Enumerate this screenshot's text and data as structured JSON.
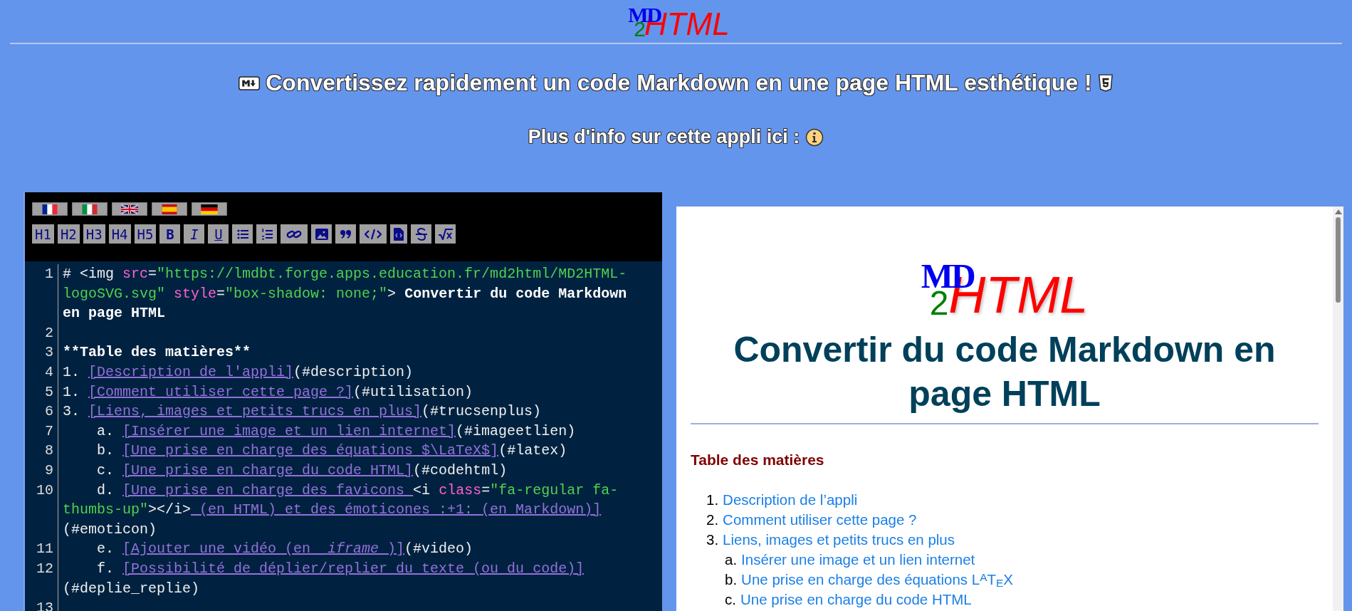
{
  "header": {
    "logo": {
      "md": "MD",
      "two": "2",
      "html": "HTML"
    },
    "title": "Convertissez rapidement un code Markdown en une page HTML esthétique !",
    "info_text": "Plus d'info sur cette appli ici :"
  },
  "editor": {
    "languages": [
      {
        "kind": "fr"
      },
      {
        "kind": "it"
      },
      {
        "kind": "gb"
      },
      {
        "kind": "es"
      },
      {
        "kind": "de"
      }
    ],
    "toolbar": [
      {
        "kind": "text",
        "label": "H1"
      },
      {
        "kind": "text",
        "label": "H2"
      },
      {
        "kind": "text",
        "label": "H3"
      },
      {
        "kind": "text",
        "label": "H4"
      },
      {
        "kind": "text",
        "label": "H5"
      },
      {
        "kind": "bold",
        "label": "B"
      },
      {
        "kind": "italic",
        "label": "I"
      },
      {
        "kind": "underline",
        "label": "U"
      },
      {
        "kind": "bullets"
      },
      {
        "kind": "numbered"
      },
      {
        "kind": "link"
      },
      {
        "kind": "image"
      },
      {
        "kind": "quote"
      },
      {
        "kind": "code"
      },
      {
        "kind": "file-code"
      },
      {
        "kind": "strike"
      },
      {
        "kind": "sqrt"
      }
    ],
    "lines": [
      {
        "number": "1",
        "segments": [
          {
            "kind": "plain",
            "text": "# <img"
          },
          {
            "kind": "attr",
            "text": " src"
          },
          {
            "kind": "plain",
            "text": "="
          },
          {
            "kind": "string",
            "text": "\"https://lmdbt.forge.apps.education.fr/md2html/MD2HTML-logoSVG.svg\""
          },
          {
            "kind": "attr",
            "text": " style"
          },
          {
            "kind": "plain",
            "text": "="
          },
          {
            "kind": "string",
            "text": "\"box-shadow: none;\""
          },
          {
            "kind": "plain",
            "text": ">"
          },
          {
            "kind": "bold",
            "text": " Convertir du code Markdown en page HTML"
          }
        ]
      },
      {
        "number": "2"
      },
      {
        "number": "3",
        "segments": [
          {
            "kind": "bold",
            "text": "**Table des matières**"
          }
        ]
      },
      {
        "number": "4",
        "segments": [
          {
            "kind": "plain",
            "text": "1. "
          },
          {
            "kind": "link",
            "text": "[Description de l'appli]"
          },
          {
            "kind": "plain",
            "text": "(#description)"
          }
        ]
      },
      {
        "number": "5",
        "segments": [
          {
            "kind": "plain",
            "text": "1. "
          },
          {
            "kind": "link",
            "text": "[Comment utiliser cette page ?]"
          },
          {
            "kind": "plain",
            "text": "(#utilisation)"
          }
        ]
      },
      {
        "number": "6",
        "segments": [
          {
            "kind": "plain",
            "text": "3. "
          },
          {
            "kind": "link",
            "text": "[Liens, images et petits trucs en plus]"
          },
          {
            "kind": "plain",
            "text": "(#trucsenplus)"
          }
        ]
      },
      {
        "number": "7",
        "segments": [
          {
            "kind": "plain",
            "text": "    a. "
          },
          {
            "kind": "link",
            "text": "[Insérer une image et un lien internet]"
          },
          {
            "kind": "plain",
            "text": "(#imageetlien)"
          }
        ]
      },
      {
        "number": "8",
        "segments": [
          {
            "kind": "plain",
            "text": "    b. "
          },
          {
            "kind": "link",
            "text": "[Une prise en charge des équations $\\LaTeX$]"
          },
          {
            "kind": "plain",
            "text": "(#latex)"
          }
        ]
      },
      {
        "number": "9",
        "segments": [
          {
            "kind": "plain",
            "text": "    c. "
          },
          {
            "kind": "link",
            "text": "[Une prise en charge du code HTML]"
          },
          {
            "kind": "plain",
            "text": "(#codehtml)"
          }
        ]
      },
      {
        "number": "10",
        "segments": [
          {
            "kind": "plain",
            "text": "    d. "
          },
          {
            "kind": "link",
            "text": "[Une prise en charge des favicons "
          },
          {
            "kind": "plain",
            "text": "<i"
          },
          {
            "kind": "attr",
            "text": " class"
          },
          {
            "kind": "plain",
            "text": "="
          },
          {
            "kind": "string",
            "text": "\"fa-regular fa-thumbs-up\""
          },
          {
            "kind": "plain",
            "text": "></i>"
          },
          {
            "kind": "link",
            "text": " (en HTML) et des émoticones :+1: (en Markdown)]"
          },
          {
            "kind": "plain",
            "text": "(#emoticon)"
          }
        ]
      },
      {
        "number": "11",
        "segments": [
          {
            "kind": "plain",
            "text": "    e. "
          },
          {
            "kind": "link",
            "text": "[Ajouter une vidéo (en _"
          },
          {
            "kind": "link-italic",
            "text": "iframe"
          },
          {
            "kind": "link",
            "text": "_)]"
          },
          {
            "kind": "plain",
            "text": "(#video)"
          }
        ]
      },
      {
        "number": "12",
        "segments": [
          {
            "kind": "plain",
            "text": "    f. "
          },
          {
            "kind": "link",
            "text": "[Possibilité de déplier/replier du texte (ou du code)]"
          },
          {
            "kind": "plain",
            "text": "(#deplie_replie)"
          }
        ]
      },
      {
        "number": "13"
      }
    ]
  },
  "preview": {
    "logo": {
      "md": "MD",
      "two": "2",
      "html": "HTML"
    },
    "heading": "Convertir du code Markdown en page HTML",
    "toc_title": "Table des matières",
    "toc": [
      {
        "marker": "1.",
        "text": "Description de l’appli"
      },
      {
        "marker": "2.",
        "text": "Comment utiliser cette page ?"
      },
      {
        "marker": "3.",
        "text": "Liens, images et petits trucs en plus",
        "children": [
          {
            "marker": "a.",
            "text": "Insérer une image et un lien internet"
          },
          {
            "marker": "b.",
            "text": "Une prise en charge des équations L$^{A}$T$_{E}$X"
          },
          {
            "marker": "c.",
            "text": "Une prise en charge du code HTML"
          }
        ]
      }
    ]
  }
}
